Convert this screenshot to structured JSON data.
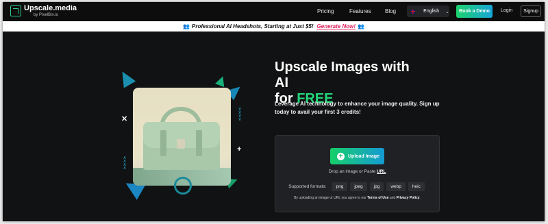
{
  "header": {
    "logo_title": "Upscale.media",
    "logo_sub": "by PixelBin.io",
    "nav": [
      "Pricing",
      "Features",
      "Blog"
    ],
    "language": "English",
    "demo_label": "Book a Demo",
    "login_label": "Login",
    "signup_label": "Signup"
  },
  "promo": {
    "text": "Professional AI Headshots, Starting at Just $5!",
    "cta": "Generate Now!"
  },
  "hero": {
    "title_line1": "Upscale Images with AI",
    "title_for": "for ",
    "title_free": "FREE",
    "description": "Leverage AI technology to enhance your image quality. Sign up today to avail your first 3 credits!"
  },
  "upload": {
    "button_label": "Upload Image",
    "drop_text": "Drop an image or Paste ",
    "url_label": "URL",
    "formats_label": "Supported formats:",
    "formats": [
      "png",
      "jpeg",
      "jpg",
      "webp",
      "heic"
    ],
    "terms_prefix": "By uploading an image or URL you agree to our ",
    "terms_link": "Terms of Use",
    "terms_and": " and ",
    "privacy_link": "Privacy Policy",
    "terms_suffix": "."
  },
  "colors": {
    "accent_green": "#22d67b",
    "accent_blue": "#159bd3",
    "promo_cta": "#e0215e",
    "background": "#111213"
  },
  "icons": [
    "logo-icon",
    "flag-uk-icon",
    "chevron-down-icon",
    "plus-icon",
    "headshot-icon"
  ]
}
